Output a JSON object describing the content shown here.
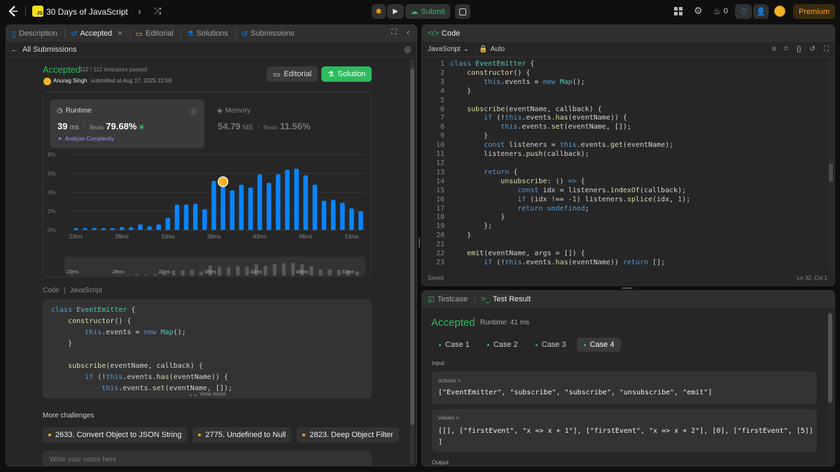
{
  "top": {
    "title": "30 Days of JavaScript",
    "submit": "Submit",
    "streak": "0",
    "premium": "Premium"
  },
  "left": {
    "tabs": [
      {
        "label": "Description"
      },
      {
        "label": "Accepted"
      },
      {
        "label": "Editorial"
      },
      {
        "label": "Solutions"
      },
      {
        "label": "Submissions"
      }
    ],
    "back": "All Submissions",
    "status": "Accepted",
    "tests": "112 / 112 testcases passed",
    "user": "Anurag Singh",
    "submitted": "submitted at Aug 17, 2025 22:58",
    "editorial_btn": "Editorial",
    "solution_btn": "Solution",
    "runtime": {
      "label": "Runtime",
      "value": "39",
      "unit": "ms",
      "beats_label": "Beats",
      "beats": "79.68%"
    },
    "memory": {
      "label": "Memory",
      "value": "54.79",
      "unit": "MB",
      "beats_label": "Beats",
      "beats": "11.56%"
    },
    "analyze": "Analyze Complexity",
    "code_header": "Code",
    "lang": "JavaScript",
    "view_more": "View more",
    "more_challenges": "More challenges",
    "challenges": [
      "2633. Convert Object to JSON String",
      "2775. Undefined to Null",
      "2823. Deep Object Filter"
    ],
    "notes_placeholder": "Write your notes here"
  },
  "chart_data": {
    "type": "bar",
    "x": [
      23,
      24,
      25,
      26,
      27,
      28,
      29,
      30,
      31,
      32,
      33,
      34,
      35,
      36,
      37,
      38,
      39,
      40,
      41,
      42,
      43,
      44,
      45,
      46,
      47,
      48,
      49,
      50,
      51,
      52,
      53,
      54
    ],
    "values": [
      0.2,
      0.2,
      0.2,
      0.2,
      0.2,
      0.3,
      0.3,
      0.6,
      0.4,
      0.6,
      1.3,
      2.7,
      2.7,
      2.8,
      2.2,
      5.2,
      4.6,
      4.2,
      4.8,
      4.5,
      5.9,
      5.0,
      5.9,
      6.4,
      6.5,
      5.8,
      4.8,
      3.1,
      3.2,
      2.9,
      2.3,
      2.0
    ],
    "xticks": [
      "23ms",
      "28ms",
      "33ms",
      "38ms",
      "43ms",
      "48ms",
      "53ms"
    ],
    "yticks": [
      "8%",
      "6%",
      "4%",
      "2%",
      "0%"
    ],
    "ylim": [
      0,
      8
    ],
    "highlight_x": 39,
    "color": "#0a84ff"
  },
  "editor": {
    "header": "Code",
    "lang": "JavaScript",
    "auto": "Auto",
    "saved": "Saved",
    "cursor": "Ln 32, Col 1"
  },
  "result": {
    "tabs": [
      "Testcase",
      "Test Result"
    ],
    "status": "Accepted",
    "runtime": "Runtime: 41 ms",
    "cases": [
      "Case 1",
      "Case 2",
      "Case 3",
      "Case 4"
    ],
    "input_label": "Input",
    "params": [
      {
        "name": "actions =",
        "value": "[\"EventEmitter\", \"subscribe\", \"subscribe\", \"unsubscribe\", \"emit\"]"
      },
      {
        "name": "values =",
        "value": "[[], [\"firstEvent\", \"x => x + 1\"], [\"firstEvent\", \"x => x + 2\"], [0], [\"firstEvent\", [5]]\n]"
      }
    ],
    "output_label": "Output"
  }
}
